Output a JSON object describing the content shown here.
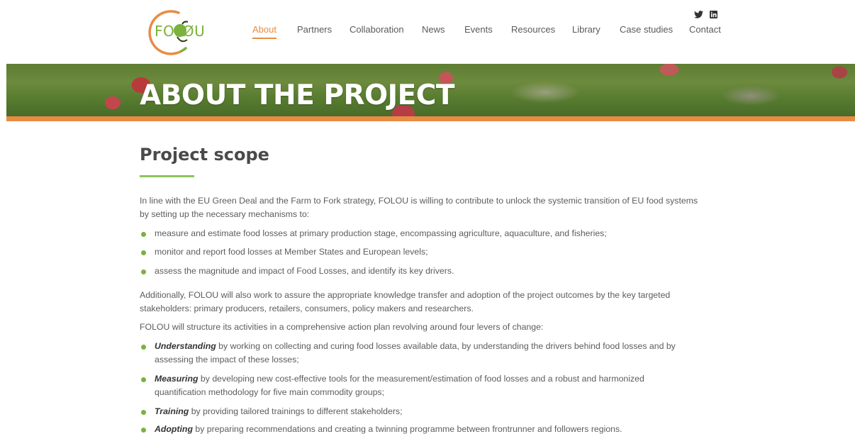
{
  "logo": {
    "text": "FOLØU",
    "name": "folou-logo"
  },
  "nav": {
    "items": [
      {
        "label": "About",
        "active": true
      },
      {
        "label": "Partners"
      },
      {
        "label": "Collaboration"
      },
      {
        "label": "News"
      },
      {
        "label": "Events"
      },
      {
        "label": "Resources"
      },
      {
        "label": "Library"
      },
      {
        "label": "Case studies"
      },
      {
        "label": "Contact"
      }
    ]
  },
  "social": [
    "twitter-icon",
    "linkedin-icon"
  ],
  "banner": {
    "title": "ABOUT THE PROJECT"
  },
  "content": {
    "section_title": "Project scope",
    "intro_line1": "In line with the EU Green Deal and the Farm to Fork strategy, FOLOU is willing to contribute to unlock the systemic transition of EU food systems",
    "intro_line2": "by setting up the necessary mechanisms to:",
    "aims": [
      "measure and estimate food losses at primary production stage, encompassing agriculture, aquaculture, and  fisheries;",
      "monitor and report food losses at Member States and European levels;",
      "assess the magnitude and impact of Food Losses, and identify its key drivers."
    ],
    "additional_line1": "Additionally, FOLOU will also work to assure the appropriate knowledge transfer and adoption of the project outcomes by the key targeted",
    "additional_line2": "stakeholders: primary producers, retailers, consumers, policy makers and researchers.",
    "levers_intro": "FOLOU will structure its activities in a comprehensive action plan revolving around four levers of change:",
    "levers": [
      {
        "term": "Understanding",
        "line1": " by working on collecting and curing food losses available data, by understanding the drivers behind food losses and by",
        "line2": "assessing the impact of these losses;"
      },
      {
        "term": "Measuring",
        "line1": " by developing new cost-effective tools for the measurement/estimation of food losses and a robust and harmonized",
        "line2": "quantification methodology for five main commodity groups;"
      },
      {
        "term": "Training",
        "line1": " by providing tailored trainings to different stakeholders;"
      },
      {
        "term": "Adopting",
        "line1": " by preparing recommendations and creating a twinning programme between frontrunner and followers regions."
      }
    ]
  },
  "colors": {
    "accent_orange": "#e78c43",
    "accent_green": "#7bb13c"
  }
}
